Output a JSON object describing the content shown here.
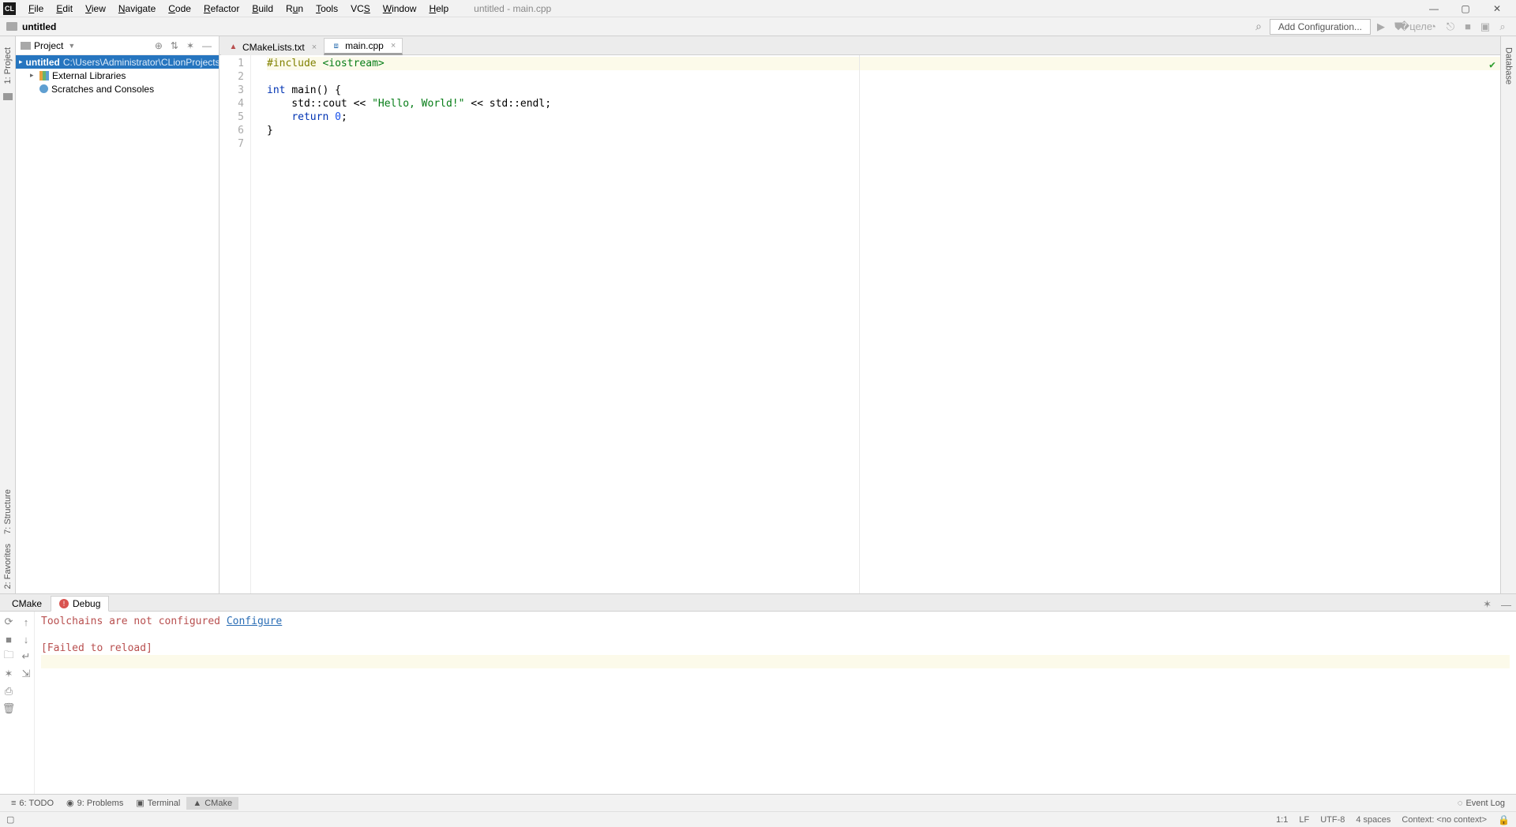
{
  "window": {
    "title": "untitled - main.cpp"
  },
  "menu": {
    "items": [
      "File",
      "Edit",
      "View",
      "Navigate",
      "Code",
      "Refactor",
      "Build",
      "Run",
      "Tools",
      "VCS",
      "Window",
      "Help"
    ]
  },
  "navbar": {
    "project": "untitled",
    "config_button": "Add Configuration..."
  },
  "project_panel": {
    "title": "Project",
    "nodes": {
      "root": {
        "name": "untitled",
        "path": "C:\\Users\\Administrator\\CLionProjects\\untitled"
      },
      "external": "External Libraries",
      "scratches": "Scratches and Consoles"
    }
  },
  "tabs": [
    {
      "name": "CMakeLists.txt",
      "icon": "cmake",
      "active": false
    },
    {
      "name": "main.cpp",
      "icon": "cpp",
      "active": true
    }
  ],
  "editor": {
    "lines": [
      {
        "n": 1,
        "segments": [
          [
            "pp",
            "#include "
          ],
          [
            "inc",
            "<iostream>"
          ]
        ]
      },
      {
        "n": 2,
        "segments": []
      },
      {
        "n": 3,
        "segments": [
          [
            "kw",
            "int "
          ],
          [
            "fn",
            "main() {"
          ]
        ]
      },
      {
        "n": 4,
        "segments": [
          [
            "",
            "    std::cout << "
          ],
          [
            "str",
            "\"Hello, World!\""
          ],
          [
            "",
            " << std::endl;"
          ]
        ]
      },
      {
        "n": 5,
        "segments": [
          [
            "",
            "    "
          ],
          [
            "kw",
            "return "
          ],
          [
            "num",
            "0"
          ],
          [
            "",
            ";"
          ]
        ]
      },
      {
        "n": 6,
        "segments": [
          [
            "",
            "}"
          ]
        ]
      },
      {
        "n": 7,
        "segments": []
      }
    ]
  },
  "bottom": {
    "tabs": {
      "cmake": "CMake",
      "debug": "Debug"
    },
    "console": {
      "error_prefix": "Toolchains are not configured ",
      "configure_link": "Configure",
      "failed": "[Failed to reload]"
    }
  },
  "toolwindows": {
    "todo": "6: TODO",
    "problems": "9: Problems",
    "terminal": "Terminal",
    "cmake": "CMake",
    "eventlog": "Event Log"
  },
  "left_tabs": {
    "project": "1: Project",
    "structure": "7: Structure",
    "favorites": "2: Favorites"
  },
  "right_tabs": {
    "database": "Database"
  },
  "status": {
    "caret": "1:1",
    "lineend": "LF",
    "encoding": "UTF-8",
    "indent": "4 spaces",
    "context": "Context: <no context>"
  }
}
